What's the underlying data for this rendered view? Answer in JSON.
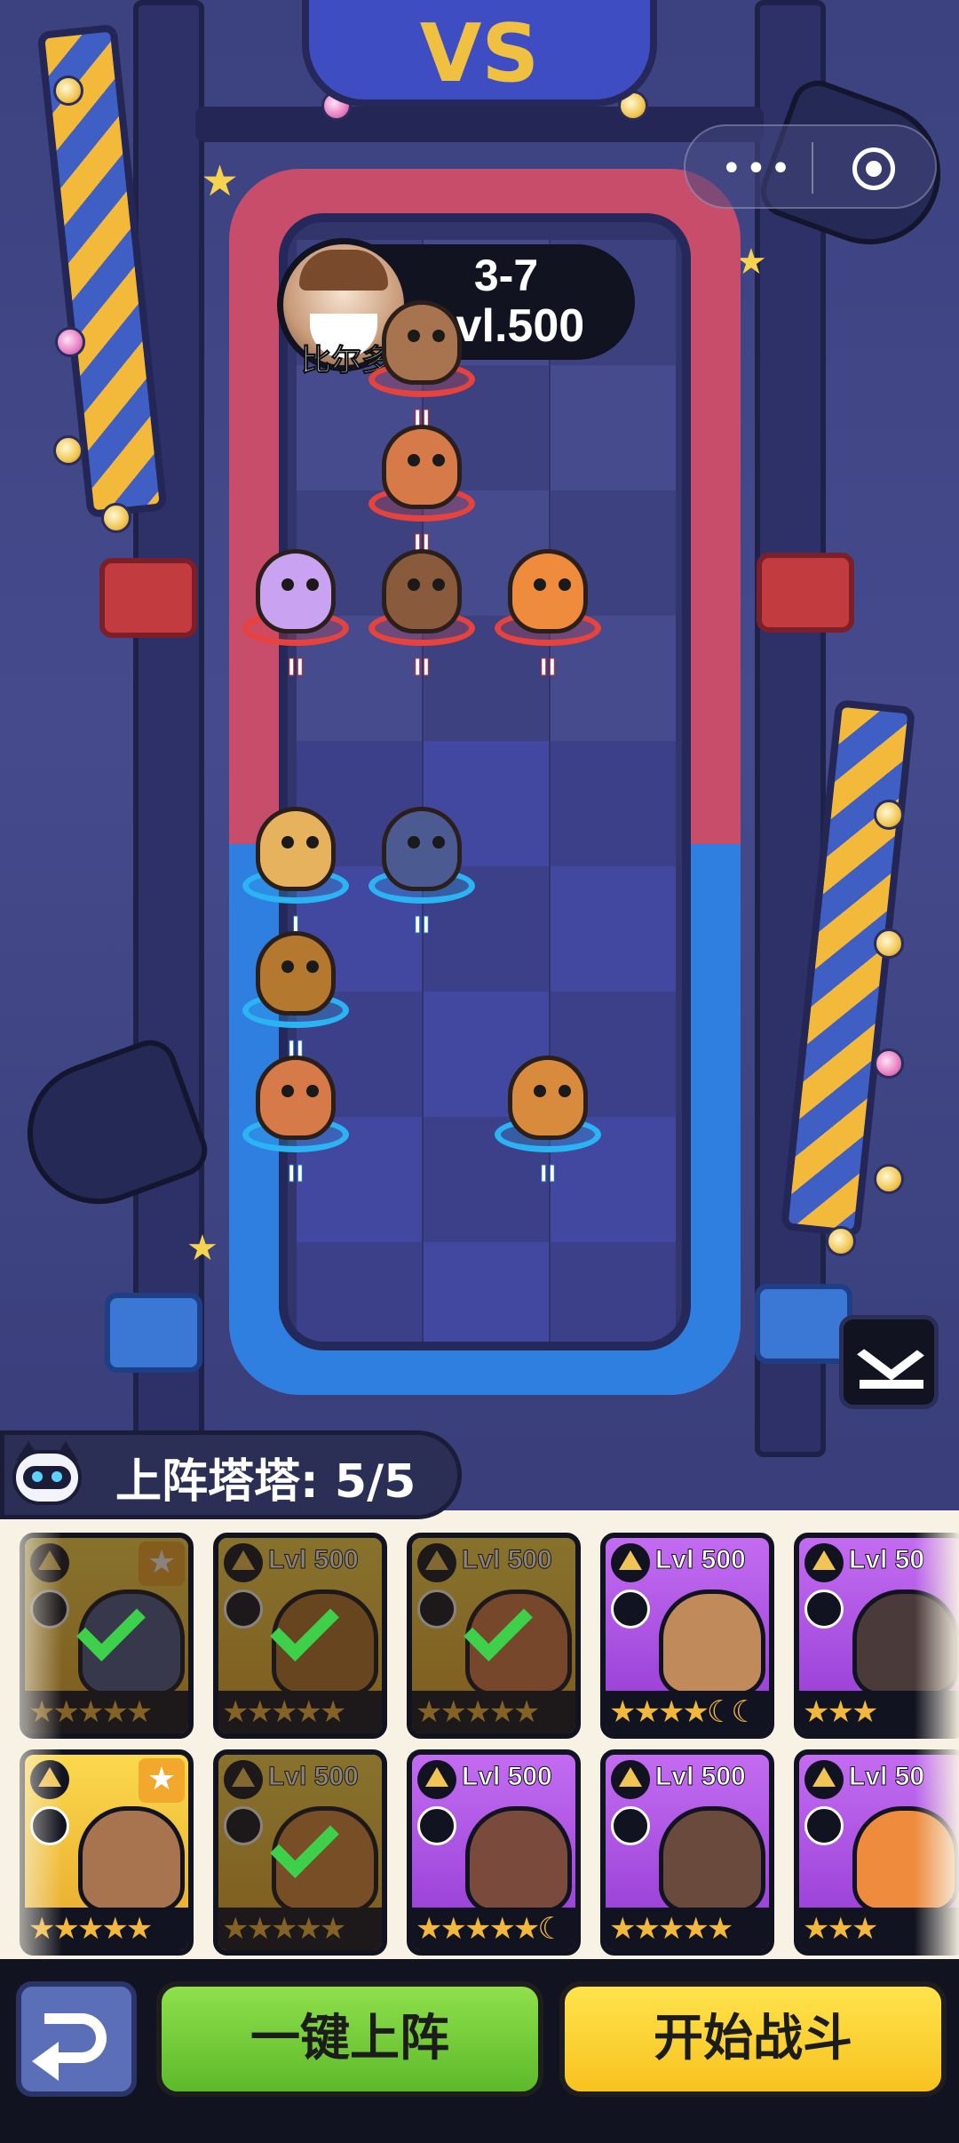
{
  "top_bar": {
    "menu_icon": "more-dots-icon",
    "close_icon": "target-circle-icon"
  },
  "arena": {
    "vs_text": "VS"
  },
  "enemy": {
    "name": "比尔多",
    "stage": "3-7",
    "level": "Lvl.500"
  },
  "board": {
    "enemy_units": [
      {
        "name": "ferret",
        "rank": "II",
        "color": "#a8744f"
      },
      {
        "name": "snake",
        "rank": "II",
        "color": "#d77a4a"
      },
      {
        "name": "purple-cat",
        "rank": "II",
        "color": "#c9a3f2"
      },
      {
        "name": "boxer-bear",
        "rank": "II",
        "color": "#8a5a3c"
      },
      {
        "name": "kangaroo",
        "rank": "II",
        "color": "#ee8b3d"
      }
    ],
    "ally_units": [
      {
        "name": "snail",
        "rank": "I",
        "color": "#e6b25e"
      },
      {
        "name": "dino",
        "rank": "II",
        "color": "#4c5a92"
      },
      {
        "name": "tortoise",
        "rank": "II",
        "color": "#b4782e"
      },
      {
        "name": "snake",
        "rank": "II",
        "color": "#d77a4a"
      },
      {
        "name": "raccoon-ball",
        "rank": "II",
        "color": "#d88a3d"
      }
    ]
  },
  "roster": {
    "label": "上阵塔塔: 5/5",
    "cards": [
      {
        "level": "",
        "tier": "gold",
        "selected": true,
        "pet_color": "#4c5a92",
        "stars": "★★★★★",
        "favorite": true
      },
      {
        "level": "Lvl 500",
        "tier": "gold",
        "selected": true,
        "pet_color": "#b4782e",
        "stars": "★★★★★",
        "favorite": false
      },
      {
        "level": "Lvl 500",
        "tier": "gold",
        "selected": true,
        "pet_color": "#d77a4a",
        "stars": "★★★★★",
        "favorite": false
      },
      {
        "level": "Lvl 500",
        "tier": "purple",
        "selected": false,
        "pet_color": "#c08a5a",
        "stars": "★★★★☾☾",
        "favorite": false
      },
      {
        "level": "Lvl 50",
        "tier": "purple",
        "selected": false,
        "pet_color": "#4a3a3a",
        "stars": "★★★",
        "favorite": false
      },
      {
        "level": "",
        "tier": "gold",
        "selected": false,
        "pet_color": "#a8744f",
        "stars": "★★★★★",
        "favorite": true
      },
      {
        "level": "Lvl 500",
        "tier": "gold",
        "selected": true,
        "pet_color": "#d88a3d",
        "stars": "★★★★★",
        "favorite": false
      },
      {
        "level": "Lvl 500",
        "tier": "purple",
        "selected": false,
        "pet_color": "#7a4a3c",
        "stars": "★★★★★☾",
        "favorite": false
      },
      {
        "level": "Lvl 500",
        "tier": "purple",
        "selected": false,
        "pet_color": "#6a4a3c",
        "stars": "★★★★★",
        "favorite": false
      },
      {
        "level": "Lvl 50",
        "tier": "purple",
        "selected": false,
        "pet_color": "#ee8b3d",
        "stars": "★★★",
        "favorite": false
      }
    ]
  },
  "buttons": {
    "back_icon": "return-arrow-icon",
    "auto_deploy": "一键上阵",
    "start_battle": "开始战斗",
    "download_icon": "download-tray-icon"
  },
  "colors": {
    "enemy_zone": "#c84d6a",
    "ally_zone": "#2f7fe0",
    "card_gold": "#f7c33a",
    "card_purple": "#a94ce0",
    "check": "#3ed04a",
    "auto_btn": "#6fcb34",
    "start_btn": "#fcd12e"
  }
}
